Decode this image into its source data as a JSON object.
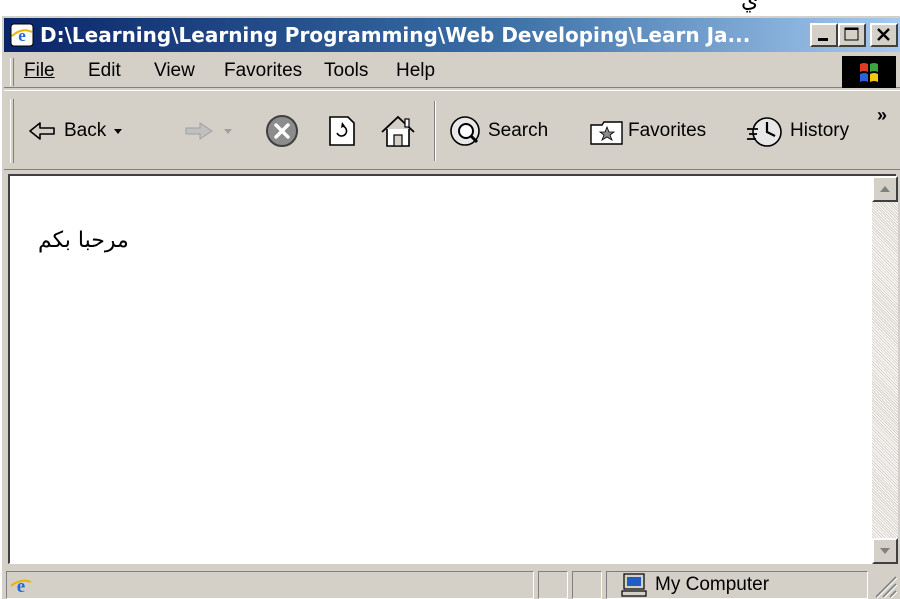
{
  "top_fragment": "ي",
  "window": {
    "title": "D:\\Learning\\Learning Programming\\Web Developing\\Learn Ja...",
    "title_icon": "ie-logo-icon"
  },
  "title_buttons": [
    {
      "name": "minimize-button",
      "icon": "minimize-icon"
    },
    {
      "name": "maximize-button",
      "icon": "maximize-icon"
    },
    {
      "name": "close-button",
      "icon": "close-icon"
    }
  ],
  "menu": {
    "file": "File",
    "edit": "Edit",
    "view": "View",
    "favorites": "Favorites",
    "tools": "Tools",
    "help": "Help",
    "throbber_icon": "windows-flag-icon"
  },
  "toolbar": {
    "back": "Back",
    "search": "Search",
    "favorites": "Favorites",
    "history": "History",
    "overflow": "»",
    "icons": [
      "back-arrow-icon",
      "forward-arrow-icon",
      "stop-icon",
      "refresh-icon",
      "home-icon",
      "search-icon",
      "favorites-icon",
      "history-icon"
    ]
  },
  "document": {
    "text": "مرحبا بكم"
  },
  "status": {
    "zone": "My Computer",
    "icons": [
      "ie-page-icon",
      "my-computer-icon",
      "resize-grip-icon"
    ]
  }
}
